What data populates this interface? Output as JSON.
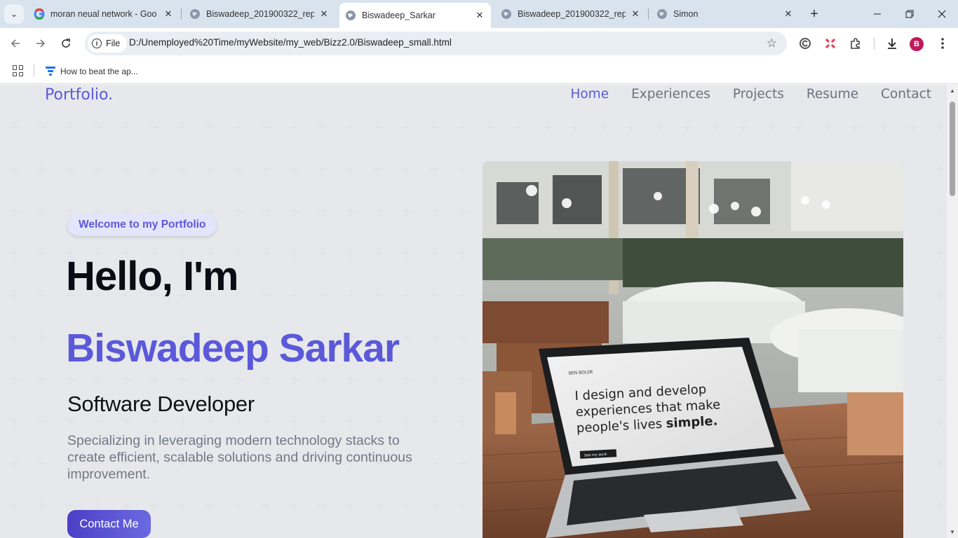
{
  "browser": {
    "tabs": [
      {
        "title": "moran neual network - Goo",
        "icon": "google-icon"
      },
      {
        "title": "Biswadeep_201900322_repo",
        "icon": "globe-icon"
      },
      {
        "title": "Biswadeep_Sarkar",
        "icon": "globe-icon",
        "active": true
      },
      {
        "title": "Biswadeep_201900322_repo",
        "icon": "globe-icon"
      },
      {
        "title": "Simon",
        "icon": "globe-icon"
      }
    ],
    "chip_label": "File",
    "url": "D:/Unemployed%20Time/myWebsite/my_web/Bizz2.0/Biswadeep_small.html",
    "profile_initial": "B",
    "bookmark": "How to beat the ap..."
  },
  "site": {
    "logo": "Portfolio.",
    "nav": [
      "Home",
      "Experiences",
      "Projects",
      "Resume",
      "Contact"
    ],
    "badge": "Welcome to my Portfolio",
    "greeting": "Hello, I'm",
    "name": "Biswadeep Sarkar",
    "role": "Software Developer",
    "description": "Specializing in leveraging modern technology stacks to create efficient, scalable solutions and driving continuous improvement.",
    "cta": "Contact Me",
    "photo_screen_text": {
      "headline_line1": "I design and develop",
      "headline_line2": "experiences that make",
      "headline_line3a": "people's lives ",
      "headline_line3b": "simple.",
      "brand": "BEN BOLDE",
      "button": "See my work"
    }
  },
  "colors": {
    "accent": "#5b59d9",
    "tabstrip": "#d9e3ee",
    "profile": "#c2185b"
  }
}
